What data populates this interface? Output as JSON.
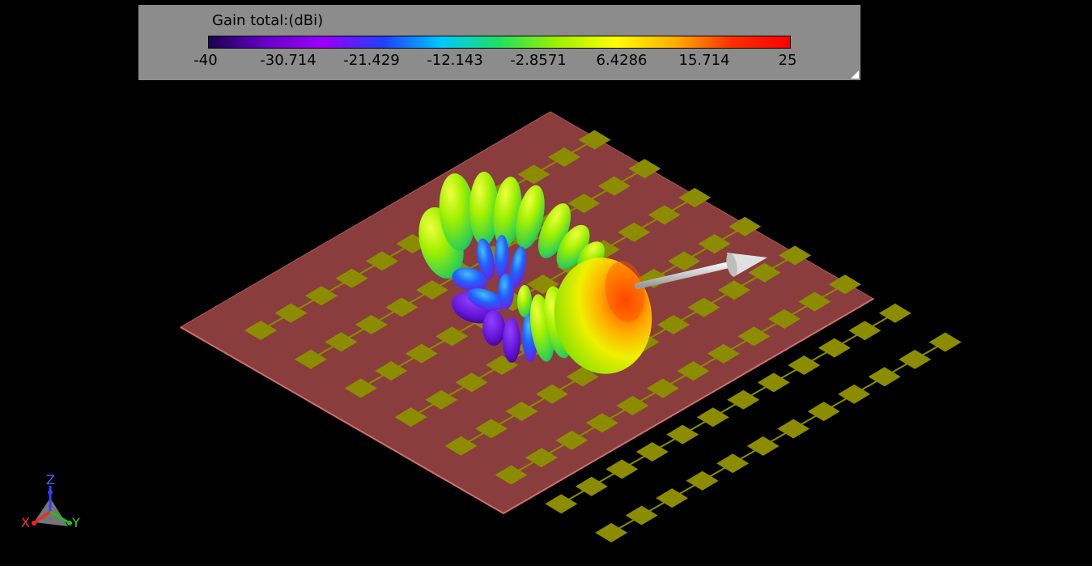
{
  "legend": {
    "title": "Gain total:(dBi)",
    "ticks": [
      "-40",
      "-30.714",
      "-21.429",
      "-12.143",
      "-2.8571",
      "6.4286",
      "15.714",
      "25"
    ],
    "colormap": [
      "#1a0050",
      "#6a00c8",
      "#9a00ff",
      "#2040ff",
      "#00c8ff",
      "#20e060",
      "#a0f000",
      "#ffff00",
      "#ffb000",
      "#ff3000",
      "#ff0000"
    ]
  },
  "axes": {
    "x_label": "X",
    "y_label": "Y",
    "z_label": "Z",
    "x_color": "#ff2020",
    "y_color": "#20c020",
    "z_color": "#3040ff"
  },
  "colors": {
    "substrate": "#8a3d3d",
    "patch": "#8c8c00",
    "arrow": "#d8d8d8",
    "background": "#000000",
    "legend_panel": "#8c8c8c"
  }
}
